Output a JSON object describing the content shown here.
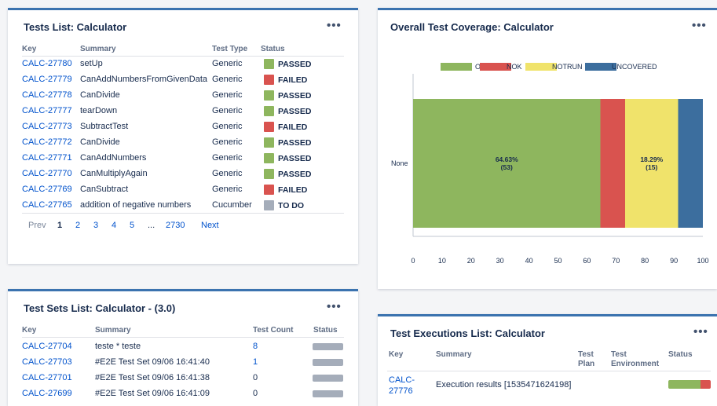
{
  "tests_list": {
    "title": "Tests List: Calculator",
    "more": "•••",
    "headers": {
      "key": "Key",
      "summary": "Summary",
      "type": "Test Type",
      "status": "Status"
    },
    "rows": [
      {
        "key": "CALC-27780",
        "summary": "setUp",
        "type": "Generic",
        "status": "PASSED",
        "color": "#8eb65e"
      },
      {
        "key": "CALC-27779",
        "summary": "CanAddNumbersFromGivenData",
        "type": "Generic",
        "status": "FAILED",
        "color": "#d9534f"
      },
      {
        "key": "CALC-27778",
        "summary": "CanDivide",
        "type": "Generic",
        "status": "PASSED",
        "color": "#8eb65e"
      },
      {
        "key": "CALC-27777",
        "summary": "tearDown",
        "type": "Generic",
        "status": "PASSED",
        "color": "#8eb65e"
      },
      {
        "key": "CALC-27773",
        "summary": "SubtractTest",
        "type": "Generic",
        "status": "FAILED",
        "color": "#d9534f"
      },
      {
        "key": "CALC-27772",
        "summary": "CanDivide",
        "type": "Generic",
        "status": "PASSED",
        "color": "#8eb65e"
      },
      {
        "key": "CALC-27771",
        "summary": "CanAddNumbers",
        "type": "Generic",
        "status": "PASSED",
        "color": "#8eb65e"
      },
      {
        "key": "CALC-27770",
        "summary": "CanMultiplyAgain",
        "type": "Generic",
        "status": "PASSED",
        "color": "#8eb65e"
      },
      {
        "key": "CALC-27769",
        "summary": "CanSubtract",
        "type": "Generic",
        "status": "FAILED",
        "color": "#d9534f"
      },
      {
        "key": "CALC-27765",
        "summary": "addition of negative numbers",
        "type": "Cucumber",
        "status": "TO DO",
        "color": "#a5adba"
      }
    ],
    "pagination": {
      "prev": "Prev",
      "pages": [
        "1",
        "2",
        "3",
        "4",
        "5"
      ],
      "current": "1",
      "ellipsis": "...",
      "last": "2730",
      "next": "Next"
    }
  },
  "coverage": {
    "title": "Overall Test Coverage: Calculator",
    "more": "•••",
    "chart_data": {
      "type": "bar",
      "orientation": "horizontal-stacked",
      "categories": [
        "None"
      ],
      "series": [
        {
          "name": "OK",
          "values": [
            64.63
          ],
          "label": "64.63%",
          "count": "(53)",
          "color": "#8eb65e"
        },
        {
          "name": "NOK",
          "values": [
            8.54
          ],
          "color": "#d9534f"
        },
        {
          "name": "NOTRUN",
          "values": [
            18.29
          ],
          "label": "18.29%",
          "count": "(15)",
          "color": "#f0e36b"
        },
        {
          "name": "UNCOVERED",
          "values": [
            8.54
          ],
          "color": "#3c6e9e"
        }
      ],
      "xlim": [
        0,
        100
      ],
      "xticks": [
        "0",
        "10",
        "20",
        "30",
        "40",
        "50",
        "60",
        "70",
        "80",
        "90",
        "100"
      ],
      "legend": "top"
    }
  },
  "test_sets": {
    "title": "Test Sets List: Calculator - (3.0)",
    "more": "•••",
    "headers": {
      "key": "Key",
      "summary": "Summary",
      "count": "Test Count",
      "status": "Status"
    },
    "rows": [
      {
        "key": "CALC-27704",
        "summary": "teste * teste",
        "count": "8"
      },
      {
        "key": "CALC-27703",
        "summary": "#E2E Test Set 09/06 16:41:40",
        "count": "1"
      },
      {
        "key": "CALC-27701",
        "summary": "#E2E Test Set 09/06 16:41:38",
        "count": "0"
      },
      {
        "key": "CALC-27699",
        "summary": "#E2E Test Set 09/06 16:41:09",
        "count": "0"
      }
    ]
  },
  "executions": {
    "title": "Test Executions List: Calculator",
    "more": "•••",
    "headers": {
      "key": "Key",
      "summary": "Summary",
      "plan1": "Test",
      "plan2": "Plan",
      "env1": "Test",
      "env2": "Environment",
      "status": "Status"
    },
    "rows": [
      {
        "key1": "CALC-",
        "key2": "27776",
        "summary": "Execution results [1535471624198]"
      }
    ],
    "status_split": {
      "passed_fraction": 0.75,
      "passed_color": "#8eb65e",
      "failed_color": "#d9534f"
    }
  }
}
